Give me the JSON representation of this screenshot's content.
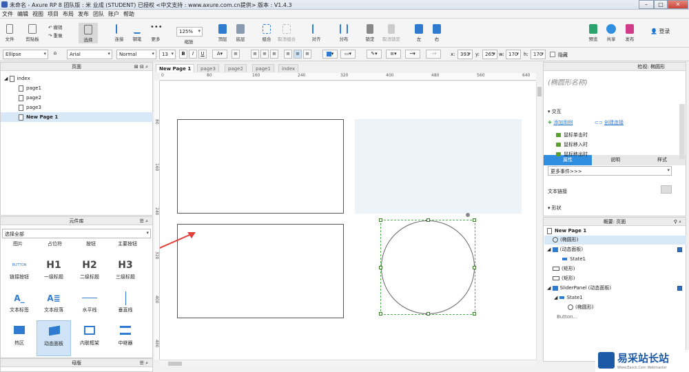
{
  "window": {
    "title": "未命名 - Axure RP 8 团队版 : 米 业成 (STUDENT) 已授权    <中文支持 : www.axure.com.cn提供> 版本 : V1.4.3"
  },
  "menu": [
    "文件",
    "编辑",
    "视图",
    "项目",
    "布局",
    "发布",
    "团队",
    "账户",
    "帮助"
  ],
  "toolbar": {
    "file": "文件",
    "clipboard": "剪贴板",
    "undo": "撤销",
    "redo": "重做",
    "select": "选择",
    "connect": "连接",
    "pen": "钢笔",
    "more": "更多",
    "zoom_value": "125%",
    "zoom_label": "缩放",
    "top": "顶层",
    "bottom": "底层",
    "group": "组合",
    "ungroup": "取消组合",
    "align": "对齐",
    "distribute": "分布",
    "lock": "锁定",
    "unlock": "取消锁定",
    "left": "左",
    "right": "右",
    "preview": "预览",
    "share": "共享",
    "publish": "发布",
    "login": "登录"
  },
  "format": {
    "widget_type": "Ellipse",
    "font": "Arial",
    "style": "Normal",
    "size": "13",
    "x_label": "x:",
    "x": "393",
    "y_label": "y:",
    "y": "265",
    "w_label": "w:",
    "w": "170",
    "h_label": "h:",
    "h": "170",
    "hidden": "隐藏"
  },
  "pages_panel": {
    "title": "页面",
    "root": "index",
    "pages": [
      "page1",
      "page2",
      "page3",
      "New Page 1"
    ]
  },
  "library": {
    "title": "元件库",
    "filter": "选择全部",
    "categories": [
      "图片",
      "占位符",
      "按钮",
      "主要按钮"
    ],
    "items": [
      {
        "label": "链接按钮",
        "glyph": "BUTTON"
      },
      {
        "label": "一级标题",
        "glyph": "H1"
      },
      {
        "label": "二级标题",
        "glyph": "H2"
      },
      {
        "label": "三级标题",
        "glyph": "H3"
      },
      {
        "label": "文本标签",
        "glyph": "A_"
      },
      {
        "label": "文本段落",
        "glyph": "A≣"
      },
      {
        "label": "水平线",
        "glyph": ""
      },
      {
        "label": "垂直线",
        "glyph": ""
      },
      {
        "label": "热区",
        "glyph": ""
      },
      {
        "label": "动态面板",
        "glyph": ""
      },
      {
        "label": "内联框架",
        "glyph": ""
      },
      {
        "label": "中继器",
        "glyph": ""
      }
    ]
  },
  "masters_panel": {
    "title": "母版"
  },
  "tabs": [
    "New Page 1",
    "page3",
    "page2",
    "page1",
    "index"
  ],
  "ruler": {
    "h": [
      "0",
      "80",
      "160",
      "240",
      "320",
      "400",
      "480",
      "560",
      "640"
    ],
    "v": [
      "80",
      "160",
      "240",
      "320",
      "400",
      "480"
    ]
  },
  "inspector": {
    "title": "检视: 椭圆形",
    "name_placeholder": "(椭圆形名称)",
    "tabs": [
      "属性",
      "说明",
      "样式"
    ],
    "section_interaction": "交互",
    "add_case": "添加用例",
    "create_link": "创建连接",
    "events": [
      "鼠标单击时",
      "鼠标移入时",
      "鼠标移出时"
    ],
    "more_events": "更多事件>>>",
    "text_link": "文本链接",
    "shape": "形状"
  },
  "outline": {
    "title": "概要: 页面",
    "page": "New Page 1",
    "rows": [
      "(椭圆形)",
      "(动态面板)",
      "State1",
      "(矩形)",
      "(矩形)",
      "SliderPanel (动态面板)",
      "State1",
      "(椭圆形)",
      "Button..."
    ]
  },
  "watermark": {
    "brand": "易采站长站",
    "url": "Www.Easck.Com Webmaster"
  },
  "colors": {
    "accent": "#2f7bd0",
    "canvas_panel": "#eef3f7",
    "selection": "#4caf50",
    "arrow": "#e0403a"
  }
}
